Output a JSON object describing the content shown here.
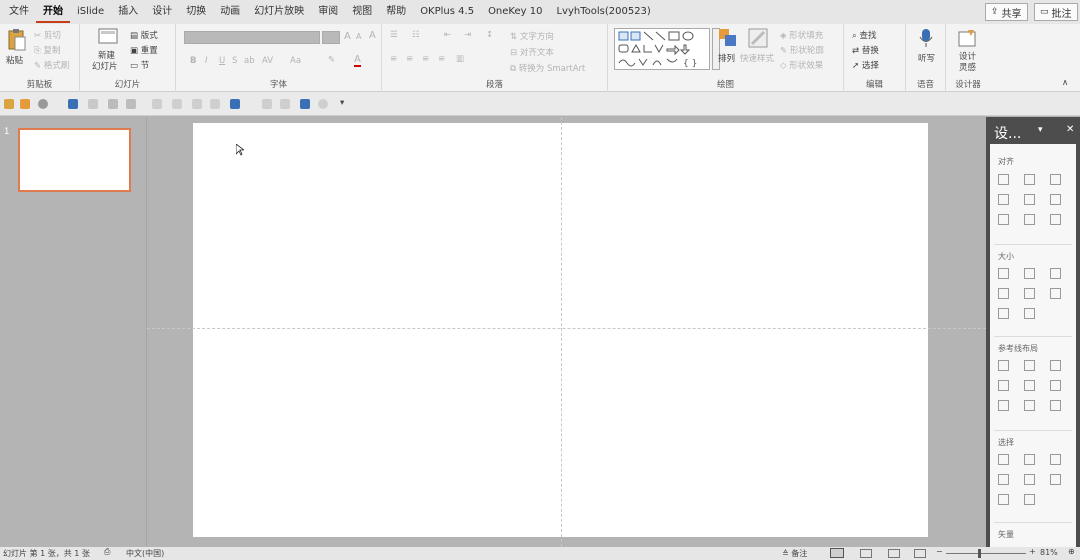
{
  "tabs": [
    {
      "label": "文件"
    },
    {
      "label": "开始"
    },
    {
      "label": "iSlide"
    },
    {
      "label": "插入"
    },
    {
      "label": "设计"
    },
    {
      "label": "切换"
    },
    {
      "label": "动画"
    },
    {
      "label": "幻灯片放映"
    },
    {
      "label": "审阅"
    },
    {
      "label": "视图"
    },
    {
      "label": "帮助"
    },
    {
      "label": "OKPlus 4.5"
    },
    {
      "label": "OneKey 10"
    },
    {
      "label": "LvyhTools(200523)"
    }
  ],
  "share_label": "共享",
  "comments_label": "批注",
  "ribbon": {
    "clipboard": {
      "paste": "粘贴",
      "cut": "剪切",
      "copy": "复制",
      "format_painter": "格式刷",
      "label": "剪贴板"
    },
    "slides": {
      "new_slide_1": "新建",
      "new_slide_2": "幻灯片",
      "layout": "版式",
      "reset": "重置",
      "section": "节",
      "label": "幻灯片"
    },
    "font": {
      "label": "字体"
    },
    "paragraph": {
      "text_direction": "文字方向",
      "align_text": "对齐文本",
      "convert_smartart": "转换为 SmartArt",
      "label": "段落"
    },
    "drawing": {
      "arrange": "排列",
      "quick_styles": "快速样式",
      "shape_fill": "形状填充",
      "shape_outline": "形状轮廓",
      "shape_effects": "形状效果",
      "label": "绘图"
    },
    "editing": {
      "find": "查找",
      "replace": "替换",
      "select": "选择",
      "label": "编辑"
    },
    "voice": {
      "dictate": "听写",
      "label": "语音"
    },
    "designer": {
      "design_1": "设计",
      "design_2": "灵感",
      "label": "设计器"
    }
  },
  "thumbnail": {
    "number": "1"
  },
  "pane": {
    "title": "设...",
    "align": "对齐",
    "size": "大小",
    "guides": "参考线布局",
    "select": "选择",
    "vector": "矢量"
  },
  "status": {
    "slide_info": "幻灯片 第 1 张，共 1 张",
    "language": "中文(中国)",
    "notes": "备注",
    "zoom": "81%"
  },
  "colors": {
    "accent": "#c43e1c",
    "thumb_border": "#e07b4f"
  }
}
